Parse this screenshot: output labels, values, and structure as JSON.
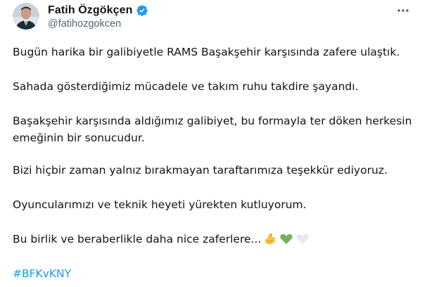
{
  "tweet": {
    "author": {
      "display_name": "Fatih Özgökçen",
      "handle": "@fatihozgokcen",
      "verified_icon": "verified-badge-icon"
    },
    "more_icon": "more-options-icon",
    "paragraphs": [
      "Bugün harika bir galibiyetle RAMS Başakşehir karşısında zafere ulaştık.",
      "Sahada gösterdiğimiz mücadele ve takım ruhu takdire şayandı.",
      "Başakşehir karşısında aldığımız galibiyet, bu formayla ter döken herkesin",
      "emeğinin bir sonucudur.",
      "Bizi hiçbir zaman yalnız bırakmayan taraftarımıza teşekkür ediyoruz.",
      "Oyuncularımızı ve teknik heyeti yürekten kutluyorum.",
      "Bu birlik ve beraberlikle daha nice zaferlere..."
    ],
    "emojis": [
      "flexed-biceps-icon",
      "green-heart-icon",
      "white-heart-icon"
    ],
    "hashtag": "#BFKvKNY",
    "colors": {
      "text": "#0f1419",
      "secondary": "#536471",
      "link": "#1d9bf0",
      "verified": "#1d9bf0"
    }
  }
}
